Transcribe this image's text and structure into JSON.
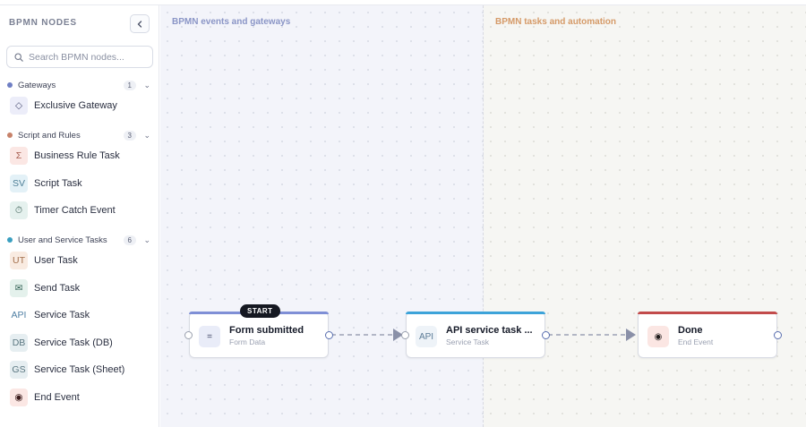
{
  "sidebar": {
    "title": "BPMN NODES",
    "collapse_icon": "chevron-left-icon",
    "search_placeholder": "Search BPMN nodes...",
    "search_value": "",
    "groups": [
      {
        "label": "Gateways",
        "count": "1",
        "color": "#6f7fc4"
      },
      {
        "label": "Script and Rules",
        "count": "3",
        "color": "#c7826a"
      },
      {
        "label": "User and Service Tasks",
        "count": "6",
        "color": "#3a9fc0"
      }
    ],
    "items": [
      {
        "label": "Exclusive Gateway",
        "icon": "◇",
        "icon_name": "diamond-icon",
        "bg": "#ecedf9",
        "fg": "#4b4f73"
      },
      {
        "label": "Business Rule Task",
        "icon": "Σ",
        "icon_name": "sigma-icon",
        "bg": "#fbe7e4",
        "fg": "#a55a4c"
      },
      {
        "label": "Script Task",
        "icon": "SV",
        "icon_name": "script-icon",
        "bg": "#e3f1f7",
        "fg": "#4e7f97"
      },
      {
        "label": "Timer Catch Event",
        "icon": "⏱",
        "icon_name": "timer-icon",
        "bg": "#e5f1ee",
        "fg": "#4a6b62"
      },
      {
        "label": "User Task",
        "icon": "UT",
        "icon_name": "user-task-icon",
        "bg": "#f9ebe1",
        "fg": "#a4704c"
      },
      {
        "label": "Send Task",
        "icon": "✉",
        "icon_name": "envelope-icon",
        "bg": "#e4f1ec",
        "fg": "#2f5f52"
      },
      {
        "label": "Service Task",
        "icon": "API",
        "icon_name": "api-icon",
        "bg": "#ffffff",
        "fg": "#4f7fa3"
      },
      {
        "label": "Service Task (DB)",
        "icon": "DB",
        "icon_name": "database-icon",
        "bg": "#e6eef1",
        "fg": "#5a7680"
      },
      {
        "label": "Service Task (Sheet)",
        "icon": "GS",
        "icon_name": "sheet-icon",
        "bg": "#e6eef1",
        "fg": "#5a7680"
      },
      {
        "label": "End Event",
        "icon": "◉",
        "icon_name": "end-event-icon",
        "bg": "#fbe7e4",
        "fg": "#3a1a1a"
      }
    ]
  },
  "canvas": {
    "lanes": [
      {
        "title": "BPMN events and gateways",
        "color": "#8a95c6"
      },
      {
        "title": "BPMN tasks and automation",
        "color": "#d59a68"
      }
    ],
    "nodes": [
      {
        "title": "Form submitted",
        "subtitle": "Form Data",
        "icon": "=",
        "icon_name": "form-icon",
        "bar_color": "#7f8fd6",
        "icon_bg": "#e9ecf8",
        "icon_fg": "#33395a",
        "badge": "START"
      },
      {
        "title": "API service task ...",
        "subtitle": "Service Task",
        "icon": "API",
        "icon_name": "api-icon",
        "bar_color": "#3da3d9",
        "icon_bg": "#eef3f8",
        "icon_fg": "#5a7a95",
        "badge": ""
      },
      {
        "title": "Done",
        "subtitle": "End Event",
        "icon": "◉",
        "icon_name": "end-event-icon",
        "bar_color": "#c24b4b",
        "icon_bg": "#fbe6e3",
        "icon_fg": "#1f1a1a",
        "badge": ""
      }
    ]
  }
}
